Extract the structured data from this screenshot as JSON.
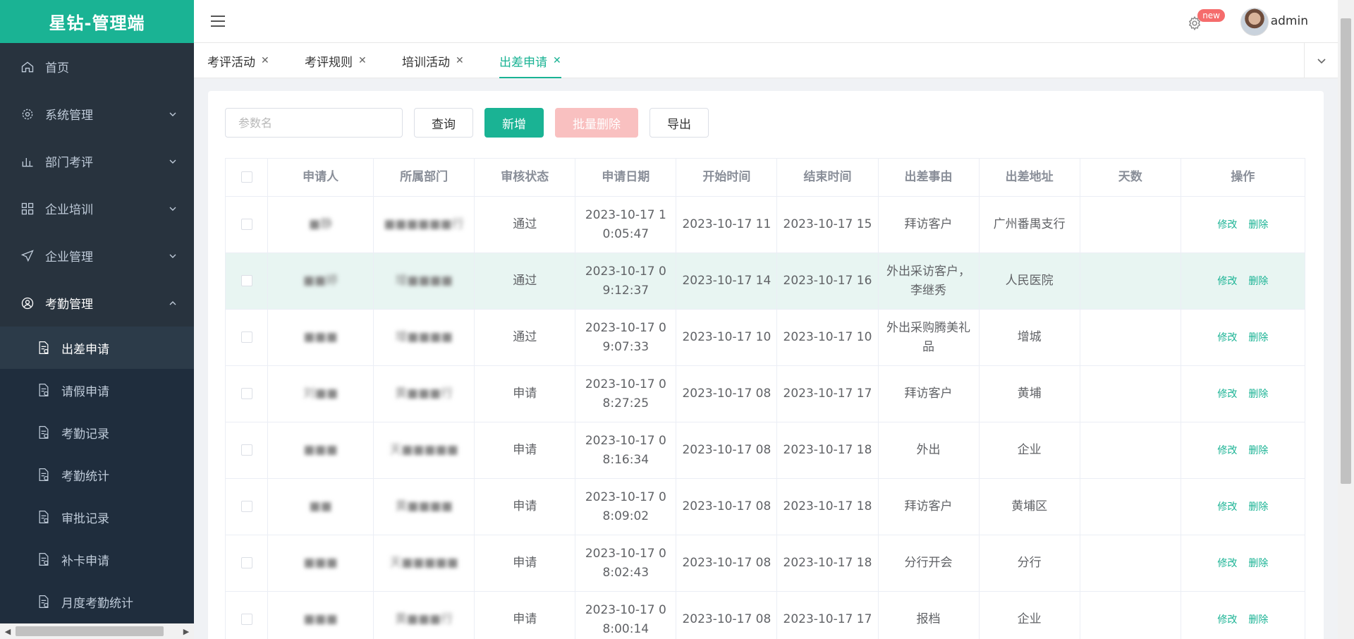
{
  "brand": "星钻-管理端",
  "menu": [
    {
      "label": "首页",
      "icon": "home-icon"
    },
    {
      "label": "系统管理",
      "icon": "gear-icon"
    },
    {
      "label": "部门考评",
      "icon": "bar-chart-icon"
    },
    {
      "label": "企业培训",
      "icon": "grid-icon"
    },
    {
      "label": "企业管理",
      "icon": "send-icon"
    },
    {
      "label": "考勤管理",
      "icon": "user-circle-icon"
    }
  ],
  "submenu": [
    {
      "label": "出差申请",
      "active": true
    },
    {
      "label": "请假申请"
    },
    {
      "label": "考勤记录"
    },
    {
      "label": "考勤统计"
    },
    {
      "label": "审批记录"
    },
    {
      "label": "补卡申请"
    },
    {
      "label": "月度考勤统计"
    }
  ],
  "header": {
    "badge": "new",
    "username": "admin"
  },
  "tabs": [
    "考评活动",
    "考评规则",
    "培训活动",
    "出差申请"
  ],
  "toolbar": {
    "search_placeholder": "参数名",
    "query": "查询",
    "add": "新增",
    "batch_delete": "批量删除",
    "export": "导出"
  },
  "table": {
    "headers": [
      "申请人",
      "所属部门",
      "审核状态",
      "申请日期",
      "开始时间",
      "结束时间",
      "出差事由",
      "出差地址",
      "天数",
      "操作"
    ],
    "edit_label": "修改",
    "delete_label": "删除",
    "rows": [
      {
        "applicant": "■静",
        "dept": "■■■■■■行",
        "status": "通过",
        "apply_date": "2023-10-17 10:05:47",
        "start": "2023-10-17 11",
        "end": "2023-10-17 15",
        "reason": "拜访客户",
        "address": "广州番禺支行",
        "days": ""
      },
      {
        "applicant": "■■婷",
        "dept": "增■■■■",
        "status": "通过",
        "apply_date": "2023-10-17 09:12:37",
        "start": "2023-10-17 14",
        "end": "2023-10-17 16",
        "reason": "外出采访客户，李继秀",
        "address": "人民医院",
        "days": ""
      },
      {
        "applicant": "■■■",
        "dept": "增■■■■",
        "status": "通过",
        "apply_date": "2023-10-17 09:07:33",
        "start": "2023-10-17 10",
        "end": "2023-10-17 10",
        "reason": "外出采购腾美礼品",
        "address": "增城",
        "days": ""
      },
      {
        "applicant": "刘■■",
        "dept": "黄■■■行",
        "status": "申请",
        "apply_date": "2023-10-17 08:27:25",
        "start": "2023-10-17 08",
        "end": "2023-10-17 17",
        "reason": "拜访客户",
        "address": "黄埔",
        "days": ""
      },
      {
        "applicant": "■■■",
        "dept": "天■■■■■",
        "status": "申请",
        "apply_date": "2023-10-17 08:16:34",
        "start": "2023-10-17 08",
        "end": "2023-10-17 18",
        "reason": "外出",
        "address": "企业",
        "days": ""
      },
      {
        "applicant": "■■",
        "dept": "黄■■■■",
        "status": "申请",
        "apply_date": "2023-10-17 08:09:02",
        "start": "2023-10-17 08",
        "end": "2023-10-17 18",
        "reason": "拜访客户",
        "address": "黄埔区",
        "days": ""
      },
      {
        "applicant": "■■■",
        "dept": "天■■■■■",
        "status": "申请",
        "apply_date": "2023-10-17 08:02:43",
        "start": "2023-10-17 08",
        "end": "2023-10-17 18",
        "reason": "分行开会",
        "address": "分行",
        "days": ""
      },
      {
        "applicant": "■■■",
        "dept": "黄■■■行",
        "status": "申请",
        "apply_date": "2023-10-17 08:00:14",
        "start": "2023-10-17 08",
        "end": "2023-10-17 17",
        "reason": "报档",
        "address": "企业",
        "days": ""
      }
    ]
  },
  "colors": {
    "accent": "#1ab394",
    "sidebar": "#28333e",
    "danger_light": "#f9c0c0",
    "badge": "#f56c6c"
  }
}
